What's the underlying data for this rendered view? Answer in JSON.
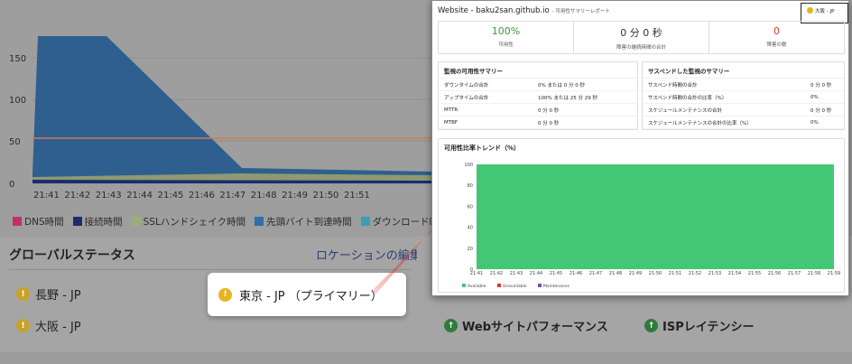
{
  "background": {
    "y_ticks": [
      "150",
      "100",
      "50",
      "0"
    ],
    "x_ticks": [
      "21:41",
      "21:42",
      "21:43",
      "21:44",
      "21:45",
      "21:46",
      "21:47",
      "21:48",
      "21:49",
      "21:50",
      "21:51"
    ],
    "legend": [
      {
        "label": "DNS時間",
        "color": "#c0306a"
      },
      {
        "label": "接続時間",
        "color": "#1a2d6e"
      },
      {
        "label": "SSLハンドシェイク時間",
        "color": "#9cad7a"
      },
      {
        "label": "先頭バイト到達時間",
        "color": "#2f6fa8"
      },
      {
        "label": "ダウンロード時間",
        "color": "#3a9fb0"
      }
    ],
    "status_title": "グローバルステータス",
    "location_edit": "ロケーションの編集",
    "locations": [
      "長野 - JP",
      "大阪 - JP"
    ],
    "highlight_location": "東京 - JP （プライマリー）",
    "perf_items": [
      "Webサイトパフォーマンス",
      "ISPレイテンシー"
    ],
    "warn_glyph": "!",
    "up_glyph": "↑"
  },
  "report": {
    "title": "Website - baku2san.github.io",
    "subtitle": "- 可用性サマリーレポート",
    "badge": "大阪 - JP",
    "kpis": [
      {
        "value": "100%",
        "label": "可用性",
        "color": "#3a9a3a"
      },
      {
        "value": "0 分 0 秒",
        "label": "障害の継続時間の合計",
        "color": "#333333"
      },
      {
        "value": "0",
        "label": "障害の数",
        "color": "#d9342b"
      }
    ],
    "monitor_summary": {
      "title": "監視の可用性サマリー",
      "rows": [
        {
          "k": "ダウンタイムの合計",
          "v": "0% または 0 分 0 秒"
        },
        {
          "k": "アップタイムの合計",
          "v": "100% または 25 分 29 秒"
        },
        {
          "k": "MTTR",
          "v": "0 分 0 秒"
        },
        {
          "k": "MTBF",
          "v": "0 分 0 秒"
        }
      ]
    },
    "suspend_summary": {
      "title": "サスペンドした監視のサマリー",
      "rows": [
        {
          "k": "サスペンド時間の合計",
          "v": "0 分 0 秒"
        },
        {
          "k": "サスペンド時間の合計の比率（%）",
          "v": "0%"
        },
        {
          "k": "スケジュールメンテナンスの合計",
          "v": "0 分 0 秒"
        },
        {
          "k": "スケジュールメンテナンスの合計の比率（%）",
          "v": "0%"
        }
      ]
    },
    "trend_title": "可用性比率トレンド（%）",
    "chart_data": {
      "type": "area",
      "x": [
        "21:41",
        "21:42",
        "21:43",
        "21:44",
        "21:45",
        "21:46",
        "21:47",
        "21:48",
        "21:49",
        "21:50",
        "21:51",
        "21:52",
        "21:53",
        "21:54",
        "21:55",
        "21:56",
        "21:57",
        "21:58",
        "21:59"
      ],
      "y_ticks": [
        "100",
        "80",
        "60",
        "40",
        "20",
        "0"
      ],
      "ylim": [
        0,
        100
      ],
      "series": [
        {
          "name": "Available",
          "color": "#44c774",
          "values": [
            100,
            100,
            100,
            100,
            100,
            100,
            100,
            100,
            100,
            100,
            100,
            100,
            100,
            100,
            100,
            100,
            100,
            100,
            100
          ]
        },
        {
          "name": "Unavailable",
          "color": "#e0332e",
          "values": [
            0,
            0,
            0,
            0,
            0,
            0,
            0,
            0,
            0,
            0,
            0,
            0,
            0,
            0,
            0,
            0,
            0,
            0,
            0
          ]
        },
        {
          "name": "Maintenance",
          "color": "#7b4fb0",
          "values": [
            0,
            0,
            0,
            0,
            0,
            0,
            0,
            0,
            0,
            0,
            0,
            0,
            0,
            0,
            0,
            0,
            0,
            0,
            0
          ]
        }
      ]
    }
  },
  "colors": {
    "arrow": "#e0302a",
    "threshold_line": "#d07a55"
  }
}
